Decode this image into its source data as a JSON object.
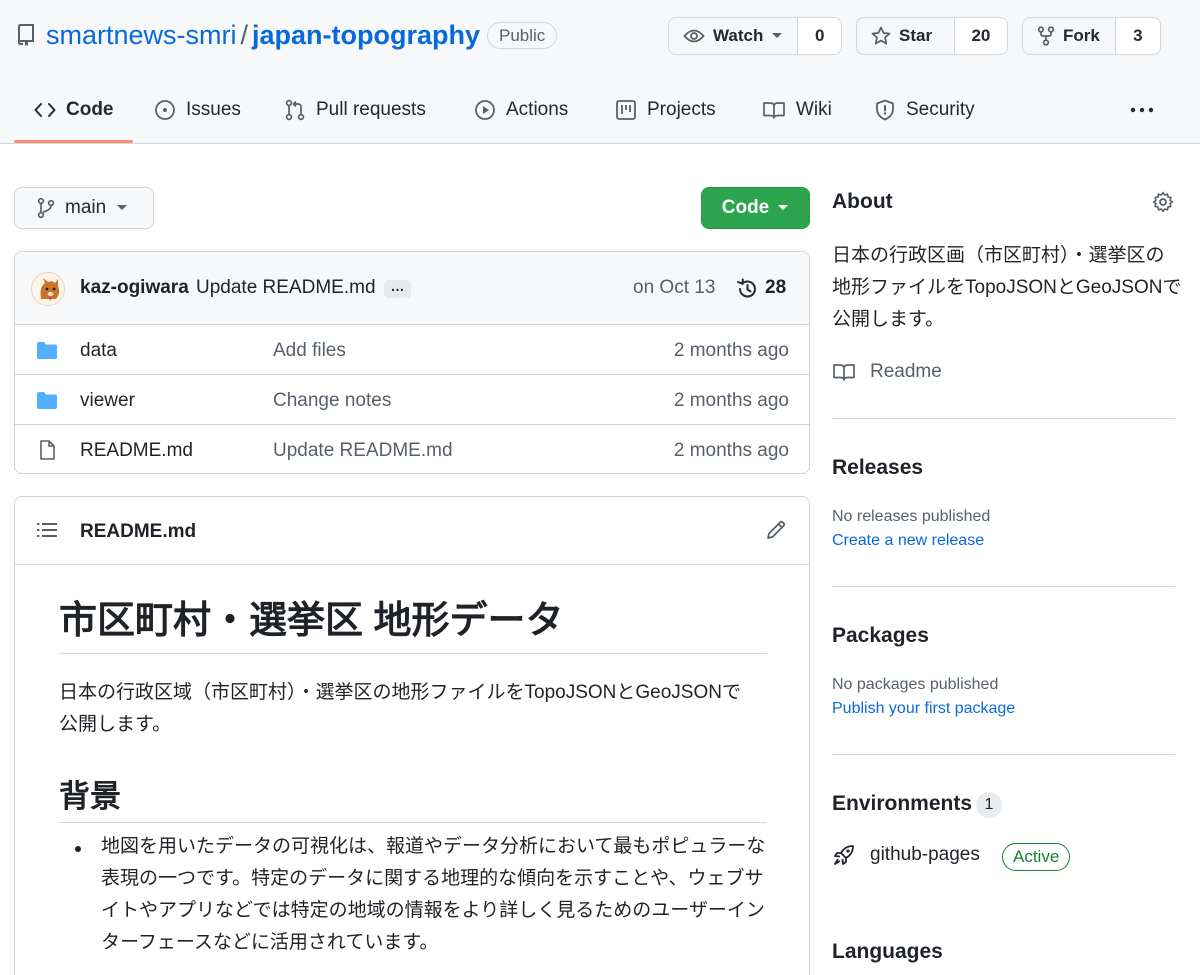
{
  "header": {
    "owner": "smartnews-smri",
    "separator": "/",
    "repo_name": "japan-topography",
    "visibility": "Public",
    "watch": {
      "label": "Watch",
      "count": "0"
    },
    "star": {
      "label": "Star",
      "count": "20"
    },
    "fork": {
      "label": "Fork",
      "count": "3"
    }
  },
  "tabs": [
    {
      "label": "Code",
      "icon": "code-icon",
      "active": true
    },
    {
      "label": "Issues",
      "icon": "issue-icon"
    },
    {
      "label": "Pull requests",
      "icon": "pull-request-icon"
    },
    {
      "label": "Actions",
      "icon": "play-icon"
    },
    {
      "label": "Projects",
      "icon": "project-icon"
    },
    {
      "label": "Wiki",
      "icon": "book-icon"
    },
    {
      "label": "Security",
      "icon": "shield-icon"
    }
  ],
  "toolbar": {
    "branch": "main",
    "code_button": "Code"
  },
  "latest_commit": {
    "author": "kaz-ogiwara",
    "message": "Update README.md",
    "ellipsis": "…",
    "date": "on Oct 13",
    "commit_count": "28"
  },
  "files": [
    {
      "type": "folder",
      "name": "data",
      "commit": "Add files",
      "age": "2 months ago"
    },
    {
      "type": "folder",
      "name": "viewer",
      "commit": "Change notes",
      "age": "2 months ago"
    },
    {
      "type": "file",
      "name": "README.md",
      "commit": "Update README.md",
      "age": "2 months ago"
    }
  ],
  "readme": {
    "filename": "README.md",
    "h1": "市区町村・選挙区 地形データ",
    "intro": "日本の行政区域（市区町村）・選挙区の地形ファイルをTopoJSONとGeoJSONで公開します。",
    "h2": "背景",
    "bullet1": "地図を用いたデータの可視化は、報道やデータ分析において最もポピュラーな表現の一つです。特定のデータに関する地理的な傾向を示すことや、ウェブサイトやアプリなどでは特定の地域の情報をより詳しく見るためのユーザーインターフェースなどに活用されています。"
  },
  "sidebar": {
    "about": {
      "heading": "About",
      "description": "日本の行政区画（市区町村）・選挙区の地形ファイルをTopoJSONとGeoJSONで公開します。",
      "readme_label": "Readme"
    },
    "releases": {
      "heading": "Releases",
      "empty_text": "No releases published",
      "link": "Create a new release"
    },
    "packages": {
      "heading": "Packages",
      "empty_text": "No packages published",
      "link": "Publish your first package"
    },
    "environments": {
      "heading": "Environments",
      "count": "1",
      "name": "github-pages",
      "status": "Active"
    },
    "languages": {
      "heading": "Languages"
    }
  },
  "colors": {
    "link": "#0969da",
    "code_button": "#2da44e",
    "active_tab_underline": "#fd8c73",
    "folder": "#54aeff",
    "active_badge": "#1a7f37"
  }
}
